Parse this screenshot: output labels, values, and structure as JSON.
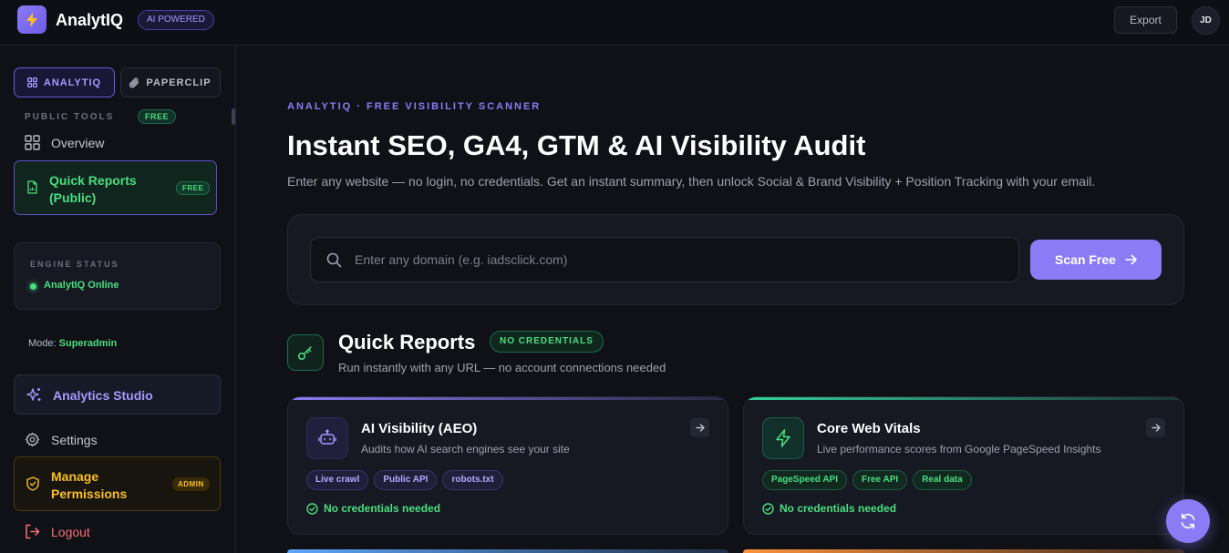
{
  "header": {
    "brand": "AnalytIQ",
    "badge": "AI POWERED",
    "export_label": "Export",
    "avatar_initials": "JD"
  },
  "sidebar": {
    "tabs": [
      {
        "label": "ANALYTIQ",
        "active": true
      },
      {
        "label": "PAPERCLIP",
        "active": false
      }
    ],
    "section_label": "PUBLIC TOOLS",
    "section_badge": "FREE",
    "items": {
      "overview": "Overview",
      "quick_reports": "Quick Reports (Public)",
      "quick_reports_badge": "FREE"
    },
    "engine": {
      "label": "ENGINE STATUS",
      "status": "AnalytIQ Online"
    },
    "mode": {
      "label": "Mode:",
      "value": "Superadmin"
    },
    "analytics_studio": "Analytics Studio",
    "settings": "Settings",
    "manage_permissions": "Manage Permissions",
    "admin_badge": "ADMIN",
    "logout": "Logout"
  },
  "main": {
    "eyebrow": "ANALYTIQ · FREE VISIBILITY SCANNER",
    "title": "Instant SEO, GA4, GTM & AI Visibility Audit",
    "subtitle": "Enter any website — no login, no credentials. Get an instant summary, then unlock Social & Brand Visibility + Position Tracking with your email.",
    "search": {
      "placeholder": "Enter any domain (e.g. iadsclick.com)",
      "value": ""
    },
    "scan_label": "Scan Free",
    "quick_reports": {
      "title": "Quick Reports",
      "badge": "NO CREDENTIALS",
      "subtitle": "Run instantly with any URL — no account connections needed"
    },
    "cards": [
      {
        "title": "AI Visibility (AEO)",
        "subtitle": "Audits how AI search engines see your site",
        "tags": [
          "Live crawl",
          "Public API",
          "robots.txt"
        ],
        "status": "No credentials needed"
      },
      {
        "title": "Core Web Vitals",
        "subtitle": "Live performance scores from Google PageSpeed Insights",
        "tags": [
          "PageSpeed API",
          "Free API",
          "Real data"
        ],
        "status": "No credentials needed"
      }
    ]
  },
  "colors": {
    "accent": "#8b7cf6",
    "success": "#4ade80",
    "warning": "#fbbf24",
    "danger": "#f87171",
    "background": "#0f1117"
  },
  "icons": {
    "logo": "bolt-icon",
    "tab_analytiq": "grid-icon",
    "tab_paperclip": "paperclip-icon",
    "overview": "grid-icon",
    "quick_reports": "file-report-icon",
    "analytics_studio": "sparkle-icon",
    "settings": "gear-icon",
    "manage_permissions": "shield-check-icon",
    "logout": "logout-icon",
    "search": "search-icon",
    "scan": "arrow-right-icon",
    "quick_reports_header": "key-icon",
    "card_aeo": "robot-icon",
    "card_cwv": "lightning-icon",
    "card_open": "arrow-right-icon",
    "card_status": "check-circle-icon",
    "fab": "refresh-icon"
  }
}
